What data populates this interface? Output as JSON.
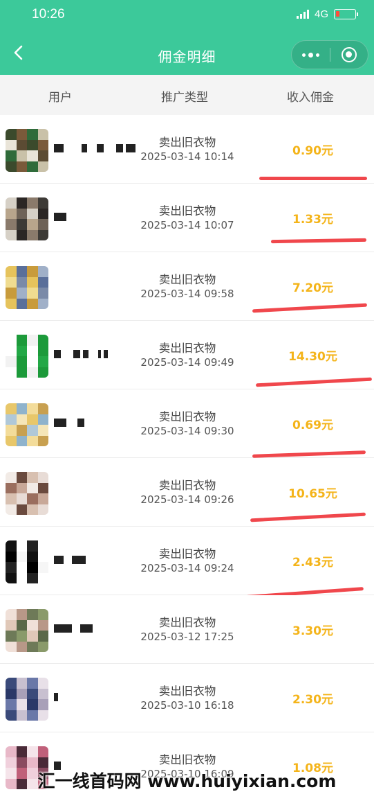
{
  "status_bar": {
    "time": "10:26",
    "network": "4G"
  },
  "nav": {
    "title": "佣金明细"
  },
  "columns": {
    "user": "用户",
    "type": "推广类型",
    "commission": "收入佣金"
  },
  "rows": [
    {
      "type": "卖出旧衣物",
      "time": "2025-03-14 10:14",
      "amount": "0.90元"
    },
    {
      "type": "卖出旧衣物",
      "time": "2025-03-14 10:07",
      "amount": "1.33元"
    },
    {
      "type": "卖出旧衣物",
      "time": "2025-03-14 09:58",
      "amount": "7.20元"
    },
    {
      "type": "卖出旧衣物",
      "time": "2025-03-14 09:49",
      "amount": "14.30元"
    },
    {
      "type": "卖出旧衣物",
      "time": "2025-03-14 09:30",
      "amount": "0.69元"
    },
    {
      "type": "卖出旧衣物",
      "time": "2025-03-14 09:26",
      "amount": "10.65元"
    },
    {
      "type": "卖出旧衣物",
      "time": "2025-03-14 09:24",
      "amount": "2.43元"
    },
    {
      "type": "卖出旧衣物",
      "time": "2025-03-12 17:25",
      "amount": "3.30元"
    },
    {
      "type": "卖出旧衣物",
      "time": "2025-03-10 16:18",
      "amount": "2.30元"
    },
    {
      "type": "卖出旧衣物",
      "time": "2025-03-10 16:09",
      "amount": "1.08元"
    }
  ],
  "watermark": {
    "text": "汇一线首码网 www.huiyixian.com"
  },
  "colors": {
    "header_green": "#3cc99a",
    "amount_gold": "#f4b41a",
    "annotation_red": "#f0474c"
  }
}
